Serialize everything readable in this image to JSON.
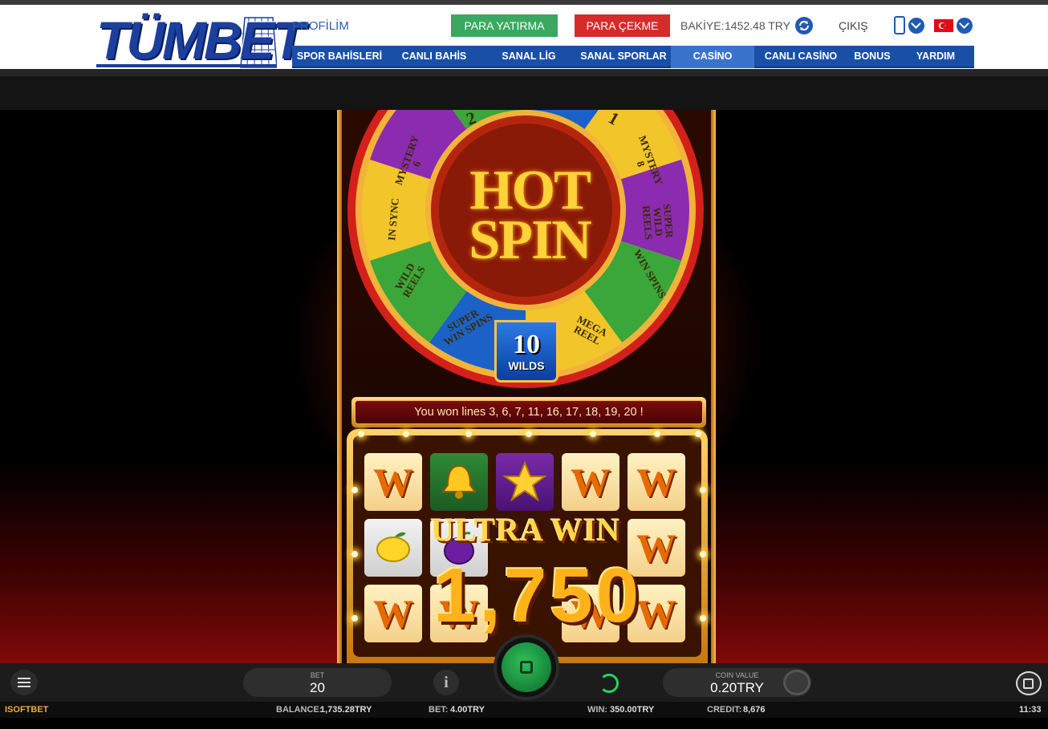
{
  "site": {
    "logo_text": "TÜMBET",
    "profile_label": "PROFİLİM",
    "deposit_label": "PARA YATIRMA",
    "withdraw_label": "PARA ÇEKME",
    "balance_label": "BAKİYE:",
    "balance_value": "1452.48 TRY",
    "logout_label": "ÇIKIŞ",
    "nav": [
      {
        "label": "SPOR BAHİSLERİ",
        "active": false
      },
      {
        "label": "CANLI BAHİS",
        "active": false
      },
      {
        "label": "SANAL LİG",
        "active": false
      },
      {
        "label": "SANAL SPORLAR",
        "active": false
      },
      {
        "label": "CASİNO",
        "active": true
      },
      {
        "label": "CANLI CASİNO",
        "active": false
      },
      {
        "label": "BONUS",
        "active": false
      },
      {
        "label": "YARDIM",
        "active": false
      }
    ],
    "colors": {
      "brand_blue": "#1a4fa6",
      "deposit_green": "#3aa860",
      "withdraw_red": "#d52b2b"
    }
  },
  "game": {
    "title_line1": "HOT",
    "title_line2": "SPIN",
    "wheel_segments": [
      "MYSTERY 6",
      "IN SYNC",
      "WILD REELS",
      "SUPER WIN SPINS",
      "MEGA REEL",
      "WIN SPINS",
      "SUPER WILD REELS",
      "MYSTERY 8",
      "2",
      "1"
    ],
    "selected_segment_number": "10",
    "selected_segment_label": "WILDS",
    "win_message": "You won lines 3, 6, 7, 11, 16, 17, 18, 19, 20 !",
    "reels": [
      [
        "W",
        "bell",
        "star",
        "W",
        "W"
      ],
      [
        "lemon",
        "plum",
        "",
        "W",
        "W"
      ],
      [
        "W",
        "W",
        "",
        "W",
        "W"
      ]
    ],
    "ultra_win_label": "ULTRA WIN",
    "win_amount": "1,750"
  },
  "controls": {
    "bet_label": "BET",
    "bet_value": "20",
    "coin_value_label": "COIN VALUE",
    "coin_value": "0.20TRY",
    "icons": [
      "menu-icon",
      "info-icon",
      "stop-icon",
      "autoplay-icon",
      "coin-icon",
      "external-link-icon"
    ]
  },
  "status": {
    "brand": "ISOFTBET",
    "balance_label": "BALANCE:",
    "balance_value": "1,735.28TRY",
    "bet_label": "BET:",
    "bet_value": "4.00TRY",
    "win_label": "WIN:",
    "win_value": "350.00TRY",
    "credit_label": "CREDIT:",
    "credit_value": "8,676",
    "time": "11:33"
  }
}
